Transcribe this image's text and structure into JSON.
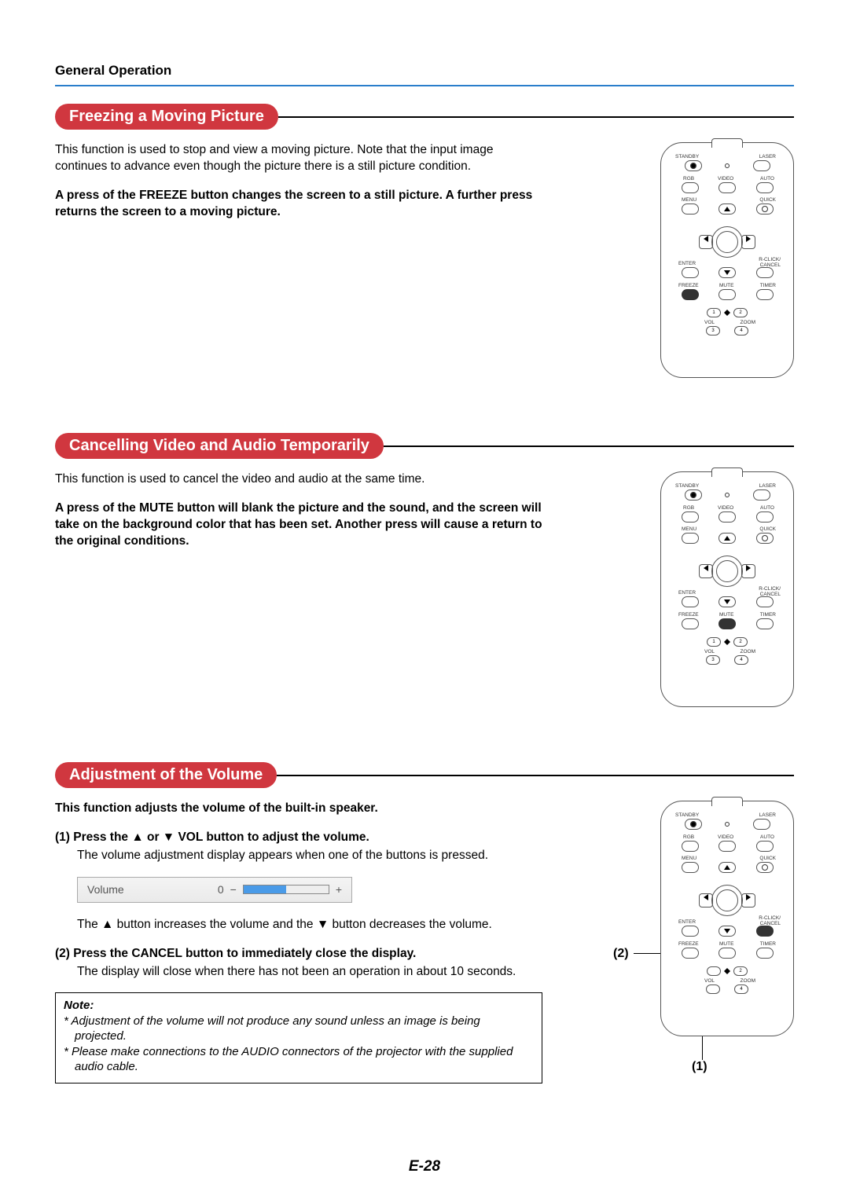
{
  "header": {
    "section": "General Operation"
  },
  "sections": {
    "freeze": {
      "title": "Freezing a Moving Picture",
      "p1": "This function is used to stop and view a moving picture. Note that the input image continues to advance even though the picture there is a still picture condition.",
      "p2": "A press of the FREEZE button changes the screen to a still picture. A further press returns the screen to a moving picture."
    },
    "mute": {
      "title": "Cancelling Video and Audio Temporarily",
      "p1": "This function is used to cancel the video and audio at the same time.",
      "p2": "A press of the MUTE button will blank the picture and the sound, and the screen will take on the background color that has been set. Another press will cause a return to the original conditions."
    },
    "volume": {
      "title": "Adjustment of the Volume",
      "intro": "This function adjusts the volume of the built-in speaker.",
      "step1_head": "(1)  Press the ▲ or ▼ VOL button to adjust the volume.",
      "step1_body": "The volume adjustment display appears when one of the buttons is pressed.",
      "vol_label": "Volume",
      "vol_value": "0",
      "vol_minus": "−",
      "vol_plus": "+",
      "step1_tail": "The ▲ button increases the volume and the ▼ button decreases the volume.",
      "step2_head": "(2)  Press the CANCEL button to immediately close the display.",
      "step2_body": "The display will close when there has not been an operation in about 10 seconds.",
      "note_title": "Note:",
      "note1": "*  Adjustment of the volume will not produce any sound unless an image is being projected.",
      "note2": "*  Please make connections to the AUDIO connectors of the projector with the supplied audio cable."
    }
  },
  "remote": {
    "labels": {
      "standby": "STANDBY",
      "laser": "LASER",
      "rgb": "RGB",
      "video": "VIDEO",
      "auto": "AUTO",
      "menu": "MENU",
      "quick": "QUICK",
      "enter": "ENTER",
      "rclick": "R-CLICK/",
      "cancel": "CANCEL",
      "freeze": "FREEZE",
      "mute": "MUTE",
      "timer": "TIMER",
      "vol": "VOL",
      "zoom": "ZOOM",
      "n1": "1",
      "n2": "2",
      "n3": "3",
      "n4": "4"
    }
  },
  "callouts": {
    "c1": "(1)",
    "c2": "(2)"
  },
  "pagenum": "E-28"
}
